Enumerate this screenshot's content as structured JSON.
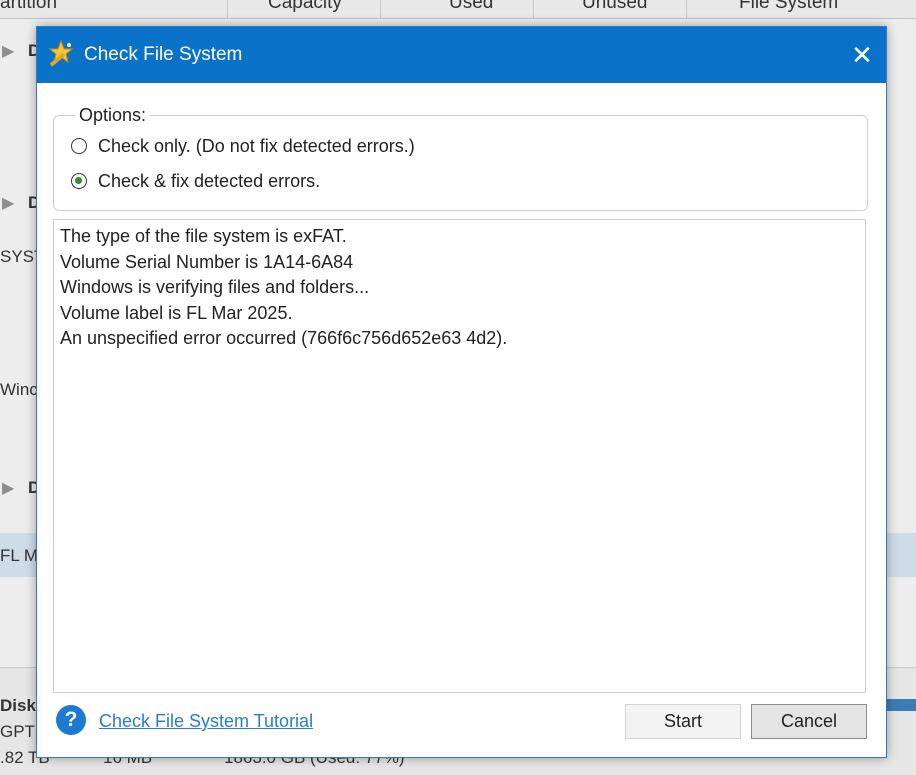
{
  "background": {
    "columns": [
      "artition",
      "Capacity",
      "Used",
      "Unused",
      "File System"
    ],
    "disk_label": "D",
    "rows": {
      "syst": "SYST",
      "wind": "Winc",
      "flm": "FL M"
    },
    "bottom": {
      "disk_title": "Disk",
      "disk_type": "GPT",
      "disk_size": ".82 TB",
      "partition_size": "16 MB",
      "partition_info": "1863.0 GB (Used: 77%)"
    }
  },
  "dialog": {
    "title": "Check File System",
    "close_icon": "close-icon",
    "options": {
      "legend": "Options:",
      "items": [
        {
          "label": "Check only. (Do not fix detected errors.)",
          "checked": false
        },
        {
          "label": "Check & fix detected errors.",
          "checked": true
        }
      ]
    },
    "log": [
      "The type of the file system is exFAT.",
      "Volume Serial Number is 1A14-6A84",
      "Windows is verifying files and folders...",
      "Volume label is FL Mar 2025.",
      "An unspecified error occurred (766f6c756d652e63 4d2)."
    ],
    "help_icon": "question-mark-icon",
    "help_link": "Check File System Tutorial",
    "buttons": {
      "start": "Start",
      "cancel": "Cancel"
    },
    "colors": {
      "titlebar": "#0b72c9",
      "link": "#2a7cd0",
      "radio_selected": "#2e8b3d"
    }
  }
}
